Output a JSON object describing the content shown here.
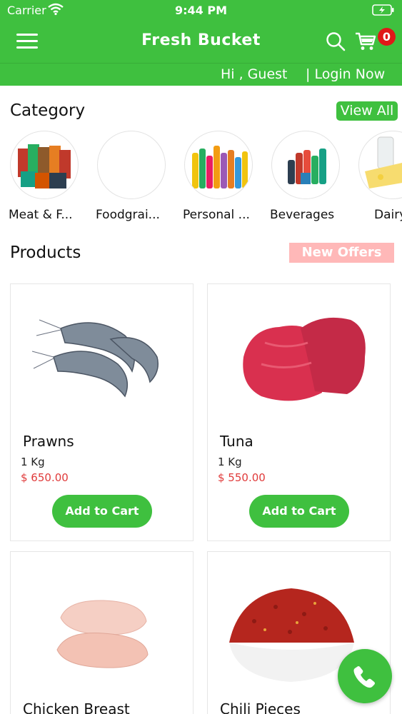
{
  "status": {
    "carrier": "Carrier",
    "time": "9:44 PM"
  },
  "header": {
    "title": "Fresh Bucket",
    "cart_count": "0",
    "icons": [
      "menu-icon",
      "search-icon",
      "cart-icon"
    ]
  },
  "guest": {
    "greeting": "Hi , Guest",
    "login": "| Login Now"
  },
  "category": {
    "title": "Category",
    "view_all": "View All",
    "items": [
      {
        "label": "Meat & F..."
      },
      {
        "label": "Foodgrai..."
      },
      {
        "label": "Personal ..."
      },
      {
        "label": "Beverages"
      },
      {
        "label": "Dairy"
      }
    ]
  },
  "products": {
    "title": "Products",
    "new_offers": "New Offers",
    "items": [
      {
        "name": "Prawns",
        "qty": "1 Kg",
        "price": "$ 650.00",
        "button": "Add to Cart"
      },
      {
        "name": "Tuna",
        "qty": "1 Kg",
        "price": "$ 550.00",
        "button": "Add to Cart"
      },
      {
        "name": "Chicken Breast"
      },
      {
        "name": "Chili Pieces"
      }
    ]
  },
  "colors": {
    "brand_green": "#3fc03f",
    "badge_red": "#e01818",
    "price_red": "#e03a3a",
    "offers_pink": "#ffb8b8"
  },
  "fab": {
    "icon": "phone-icon"
  }
}
